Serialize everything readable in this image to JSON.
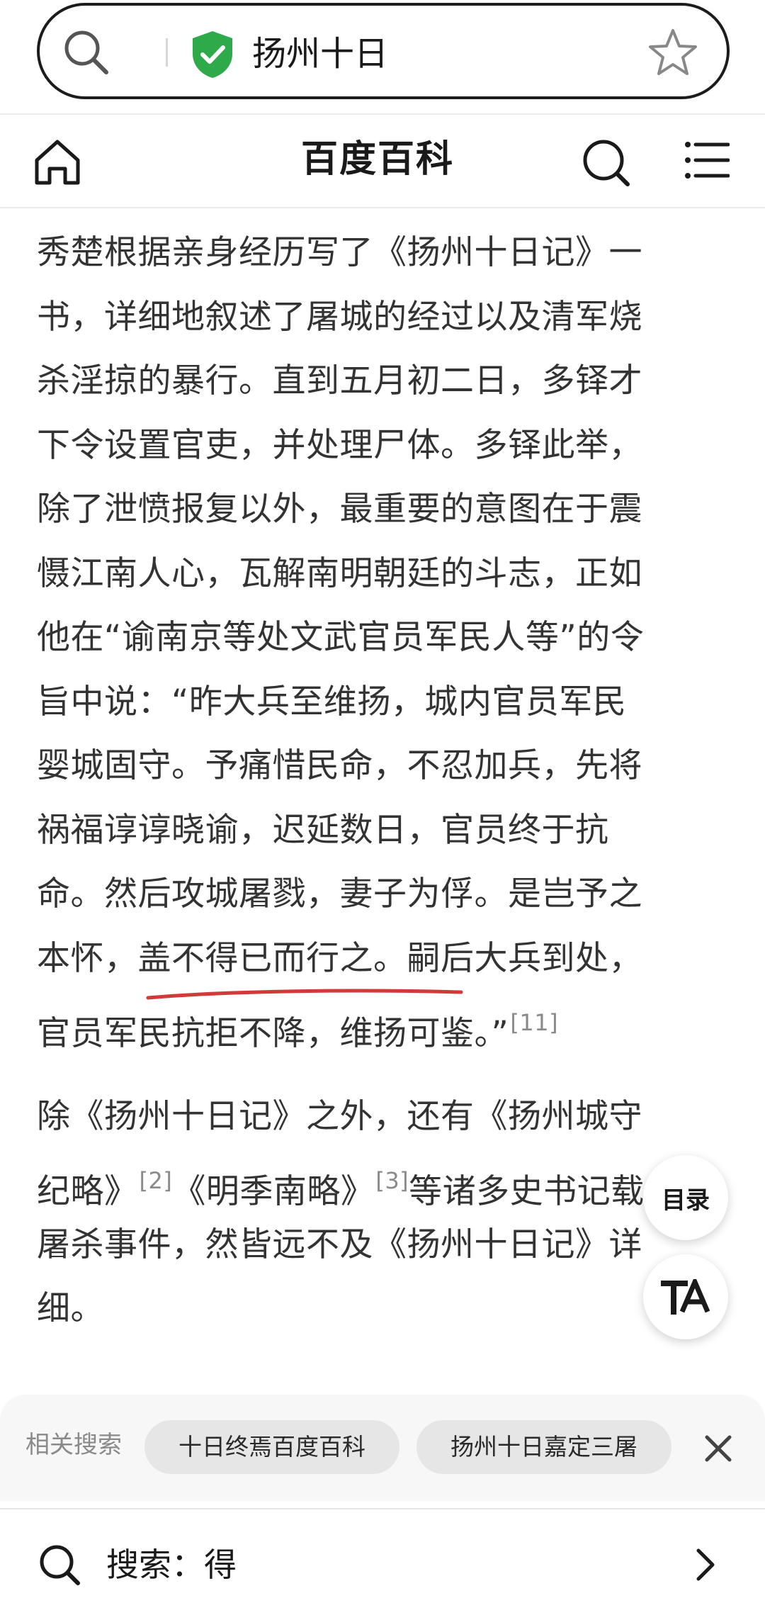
{
  "search": {
    "query": "扬州十日"
  },
  "header": {
    "title": "百度百科"
  },
  "article": {
    "paragraph1": [
      "秀楚根据亲身经历写了《扬州十日记》一",
      "书，详细地叙述了屠城的经过以及清军烧",
      "杀淫掠的暴行。直到五月初二日，多铎才",
      "下令设置官吏，并处理尸体。多铎此举，",
      "除了泄愤报复以外，最重要的意图在于震",
      "慑江南人心，瓦解南明朝廷的斗志，正如",
      "他在“谕南京等处文武官员军民人等”的令",
      "旨中说：“昨大兵至维扬，城内官员军民",
      "婴城固守。予痛惜民命，不忍加兵，先将",
      "祸福谆谆晓谕，迟延数日，官员终于抗",
      "命。然后攻城屠戮，妻子为俘。是岂予之",
      "本怀，盖不得已而行之。嗣后大兵到处，",
      "官员军民抗拒不降，维扬可鉴。”"
    ],
    "citation1": "[11]",
    "paragraph2": {
      "line1": "除《扬州十日记》之外，还有《扬州城守",
      "line2a": "纪略》",
      "cite2": "[2]",
      "line2b": "《明季南略》",
      "cite3": "[3]",
      "line2c": "等诸多史书记载",
      "line3": "屠杀事件，然皆远不及《扬州十日记》详",
      "line4": "细。"
    }
  },
  "floating": {
    "toc_label": "目录",
    "ta_label": "TA"
  },
  "related": {
    "label": "相关搜索",
    "chips": [
      "十日终焉百度百科",
      "扬州十日嘉定三屠"
    ]
  },
  "bottom_search": {
    "text": "搜索：得"
  },
  "colors": {
    "shield": "#2eaa4a",
    "underline": "#d23a3a"
  }
}
